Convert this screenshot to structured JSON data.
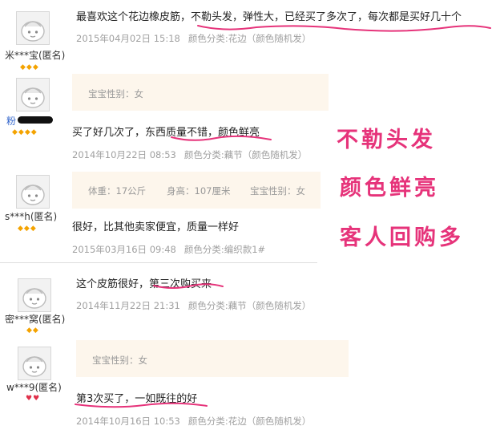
{
  "reviews": [
    {
      "username": "米***宝(匿名)",
      "text": "最喜欢这个花边橡皮筋，不勒头发，弹性大，已经买了多次了，每次都是买好几十个",
      "date": "2015年04月02日 15:18",
      "variant": "颜色分类:花边（颜色随机发）",
      "stars": "◆◆◆"
    },
    {
      "username": "粉",
      "info": [
        "宝宝性别：女"
      ],
      "text": "买了好几次了，东西质量不错，颜色鲜亮",
      "date": "2014年10月22日 08:53",
      "variant": "颜色分类:藕节（颜色随机发）",
      "stars": "◆◆◆◆"
    },
    {
      "username": "s***h(匿名)",
      "info": [
        "体重：17公斤",
        "身高：107厘米",
        "宝宝性别：女"
      ],
      "text": "很好，比其他卖家便宜，质量一样好",
      "date": "2015年03月16日 09:48",
      "variant": "颜色分类:编织款1#",
      "stars": "◆◆◆"
    },
    {
      "username": "密***窝(匿名)",
      "text": "这个皮筋很好，第三次购买来",
      "date": "2014年11月22日 21:31",
      "variant": "颜色分类:藕节（颜色随机发）",
      "stars": "◆◆"
    },
    {
      "username": "w***9(匿名)",
      "info": [
        "宝宝性别：女"
      ],
      "text": "第3次买了，一如既往的好",
      "date": "2014年10月16日 10:53",
      "variant": "颜色分类:花边（颜色随机发）",
      "stars": "♥♥"
    }
  ],
  "callouts": [
    "不勒头发",
    "颜色鲜亮",
    "客人回购多"
  ],
  "colors": {
    "callout": "#e6337a",
    "underline": "#e6337a",
    "meta": "#a0a0a0",
    "infobox": "#fdf6ec",
    "star": "#f4a300",
    "heart": "#e0304a"
  },
  "icons": {
    "avatar": "default-avatar-icon",
    "level": "diamond-icon",
    "heart_level": "heart-icon"
  }
}
